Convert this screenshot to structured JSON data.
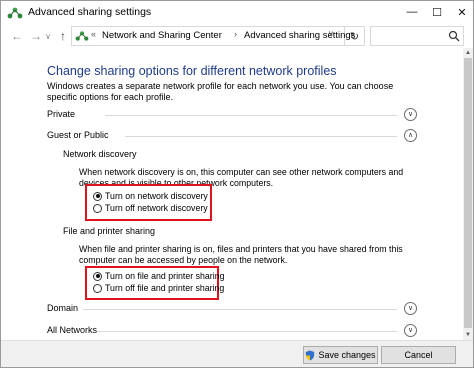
{
  "window": {
    "title": "Advanced sharing settings",
    "controls": {
      "minimize": "—",
      "maximize": "☐",
      "close": "✕"
    }
  },
  "navbar": {
    "back": "←",
    "forward": "→",
    "dropdown": "∨",
    "up": "↑",
    "address_separator": "«",
    "crumbs": [
      "Network and Sharing Center",
      "Advanced sharing settings"
    ],
    "crumb_separator": "›",
    "address_dropdown": "∨",
    "refresh": "↻",
    "search_placeholder": ""
  },
  "content": {
    "heading": "Change sharing options for different network profiles",
    "description": "Windows creates a separate network profile for each network you use. You can choose specific options for each profile.",
    "profiles": {
      "private": {
        "label": "Private",
        "expander": "∨"
      },
      "guest_public": {
        "label": "Guest or Public",
        "expander": "∧"
      },
      "domain": {
        "label": "Domain",
        "expander": "∨"
      },
      "all_networks": {
        "label": "All Networks",
        "expander": "∨"
      }
    },
    "network_discovery": {
      "label": "Network discovery",
      "description": "When network discovery is on, this computer can see other network computers and devices and is visible to other network computers.",
      "options": [
        {
          "label": "Turn on network discovery",
          "selected": true
        },
        {
          "label": "Turn off network discovery",
          "selected": false
        }
      ]
    },
    "file_printer_sharing": {
      "label": "File and printer sharing",
      "description": "When file and printer sharing is on, files and printers that you have shared from this computer can be accessed by people on the network.",
      "options": [
        {
          "label": "Turn on file and printer sharing",
          "selected": true
        },
        {
          "label": "Turn off file and printer sharing",
          "selected": false
        }
      ]
    }
  },
  "footer": {
    "save_label": "Save changes",
    "cancel_label": "Cancel"
  },
  "colors": {
    "heading": "#1e3c8c",
    "highlight_box": "#e0141e",
    "network_icon": "#2e8b3a"
  },
  "icons": {
    "title": "network-sharing-icon",
    "address": "network-sharing-icon",
    "search": "search-icon",
    "save": "uac-shield-icon"
  }
}
